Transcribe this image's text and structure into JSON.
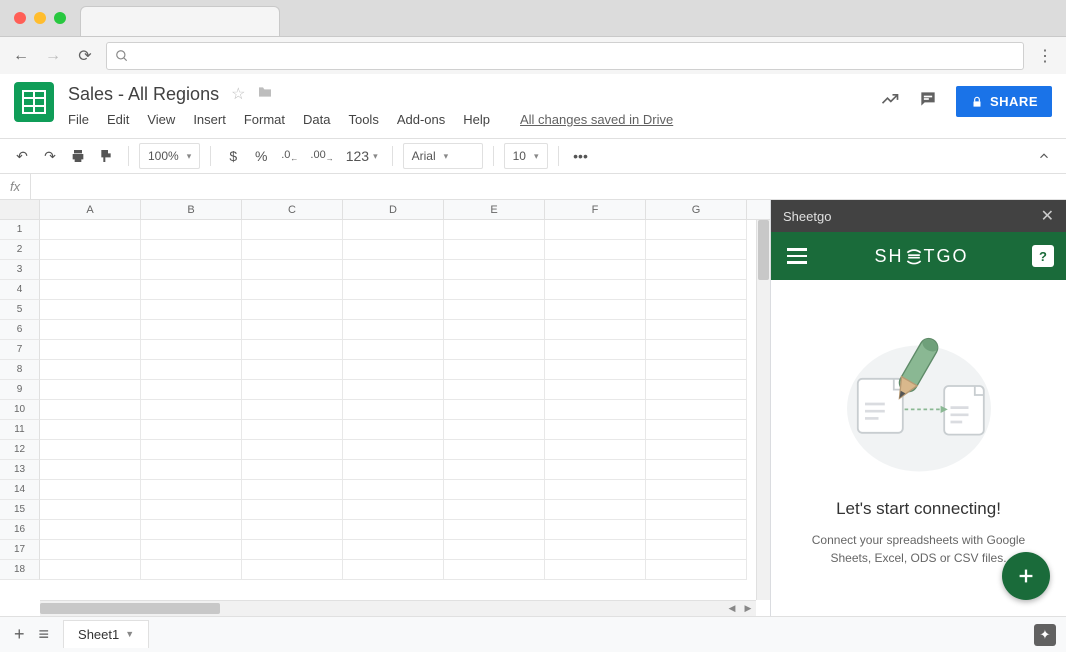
{
  "document": {
    "title": "Sales - All Regions",
    "save_status": "All changes saved in Drive"
  },
  "menu": {
    "file": "File",
    "edit": "Edit",
    "view": "View",
    "insert": "Insert",
    "format": "Format",
    "data": "Data",
    "tools": "Tools",
    "addons": "Add-ons",
    "help": "Help"
  },
  "header_actions": {
    "share": "SHARE"
  },
  "toolbar": {
    "zoom": "100%",
    "currency": "$",
    "percent": "%",
    "dec_dec": ".0",
    "inc_dec": ".00",
    "num_format": "123",
    "font": "Arial",
    "font_size": "10",
    "more": "•••"
  },
  "formula_bar": {
    "fx": "fx"
  },
  "grid": {
    "columns": [
      "A",
      "B",
      "C",
      "D",
      "E",
      "F",
      "G"
    ],
    "rows": [
      "1",
      "2",
      "3",
      "4",
      "5",
      "6",
      "7",
      "8",
      "9",
      "10",
      "11",
      "12",
      "13",
      "14",
      "15",
      "16",
      "17",
      "18"
    ]
  },
  "sidebar": {
    "title": "Sheetgo",
    "brand_pre": "SH",
    "brand_post": "TGO",
    "headline": "Let's start connecting!",
    "description": "Connect your spreadsheets with Google Sheets, Excel, ODS or CSV files."
  },
  "sheet_tabs": {
    "sheet1": "Sheet1"
  }
}
